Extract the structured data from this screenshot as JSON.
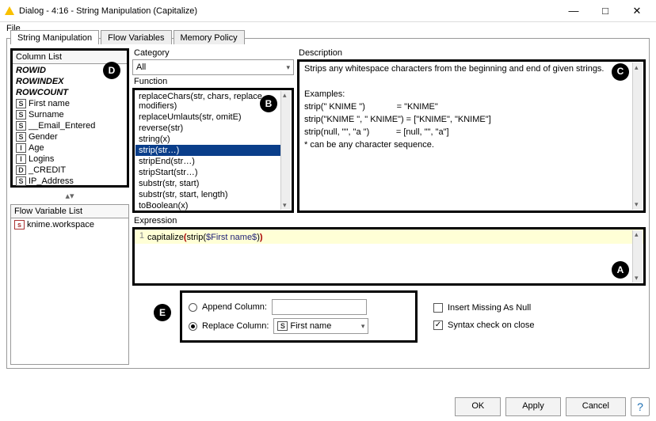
{
  "window": {
    "title": "Dialog - 4:16 - String Manipulation (Capitalize)",
    "min": "—",
    "max": "□",
    "close": "✕"
  },
  "menu": {
    "file": "File"
  },
  "tabs": {
    "t0": "String Manipulation",
    "t1": "Flow Variables",
    "t2": "Memory Policy"
  },
  "columnList": {
    "title": "Column List",
    "rowid": "ROWID",
    "rowindex": "ROWINDEX",
    "rowcount": "ROWCOUNT",
    "items": [
      {
        "type": "S",
        "label": "First name"
      },
      {
        "type": "S",
        "label": "Surname"
      },
      {
        "type": "S",
        "label": "__Email_Entered"
      },
      {
        "type": "S",
        "label": "Gender"
      },
      {
        "type": "I",
        "label": "Age"
      },
      {
        "type": "I",
        "label": "Logins"
      },
      {
        "type": "D",
        "label": "_CREDIT"
      },
      {
        "type": "S",
        "label": "IP_Address"
      }
    ]
  },
  "flowVarList": {
    "title": "Flow Variable List",
    "items": [
      {
        "type": "s",
        "label": "knime.workspace"
      }
    ]
  },
  "category": {
    "label": "Category",
    "value": "All"
  },
  "function": {
    "label": "Function",
    "items": [
      "replaceChars(str, chars, replace, modifiers)",
      "replaceUmlauts(str, omitE)",
      "reverse(str)",
      "string(x)",
      "strip(str…)",
      "stripEnd(str…)",
      "stripStart(str…)",
      "substr(str, start)",
      "substr(str, start, length)",
      "toBoolean(x)"
    ],
    "selectedIndex": 4
  },
  "description": {
    "label": "Description",
    "line0": "Strips any whitespace characters from the beginning and end of given strings.",
    "line1": "Examples:",
    "line2": "strip(\" KNIME \")             = \"KNIME\"",
    "line3": "strip(\"KNIME \", \" KNIME\") = [\"KNIME\", \"KNIME\"]",
    "line4": "strip(null, \"\", \"a \")           = [null, \"\", \"a\"]",
    "line5": "* can be any character sequence."
  },
  "expression": {
    "label": "Expression",
    "lineno": "1",
    "fn1": "capitalize",
    "fn2": "strip",
    "var": "$First name$"
  },
  "output": {
    "appendLabel": "Append Column:",
    "appendValue": "",
    "replaceLabel": "Replace Column:",
    "replaceType": "S",
    "replaceValue": "First name",
    "insertMissing": "Insert Missing As Null",
    "syntaxCheck": "Syntax check on close"
  },
  "buttons": {
    "ok": "OK",
    "apply": "Apply",
    "cancel": "Cancel"
  },
  "badges": {
    "a": "A",
    "b": "B",
    "c": "C",
    "d": "D",
    "e": "E"
  }
}
